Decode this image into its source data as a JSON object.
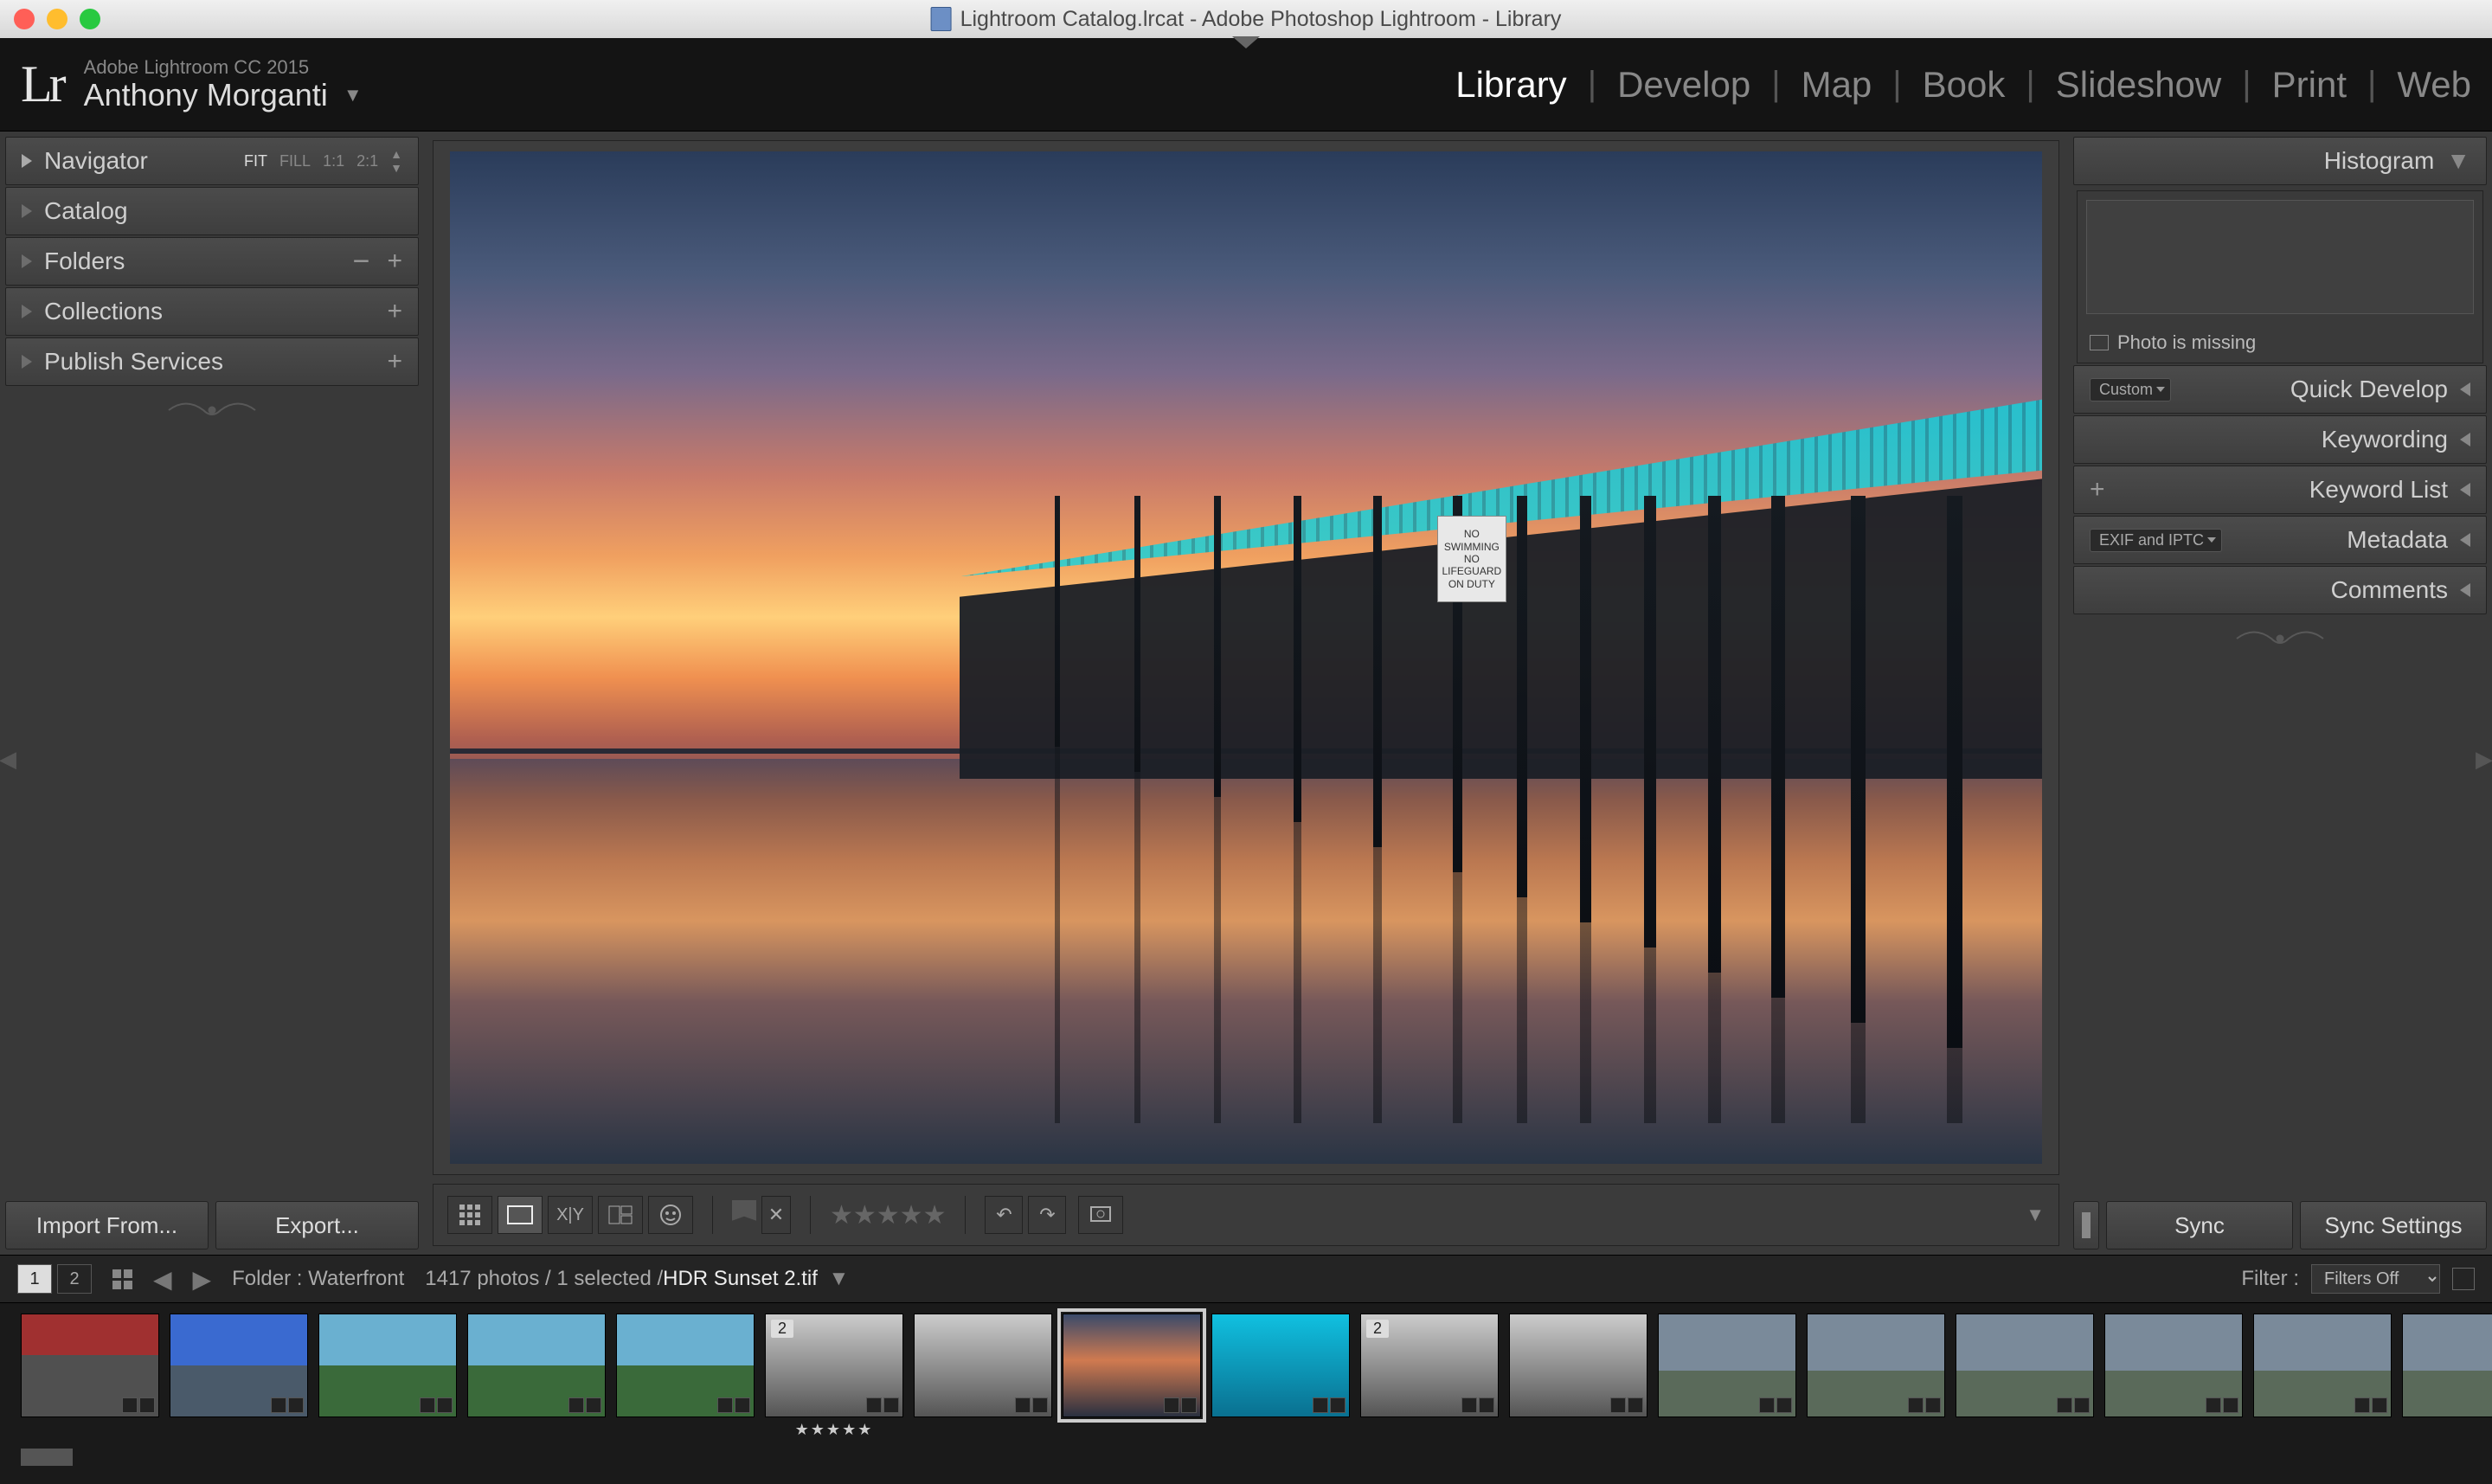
{
  "window": {
    "title": "Lightroom Catalog.lrcat - Adobe Photoshop Lightroom - Library"
  },
  "identity": {
    "product": "Adobe Lightroom CC 2015",
    "user": "Anthony Morganti",
    "logo": "Lr"
  },
  "modules": [
    "Library",
    "Develop",
    "Map",
    "Book",
    "Slideshow",
    "Print",
    "Web"
  ],
  "active_module": "Library",
  "left_panels": {
    "navigator": {
      "label": "Navigator",
      "fit": "FIT",
      "fill": "FILL",
      "one": "1:1",
      "two": "2:1"
    },
    "catalog": "Catalog",
    "folders": "Folders",
    "collections": "Collections",
    "publish": "Publish Services"
  },
  "left_actions": {
    "import": "Import From...",
    "export": "Export..."
  },
  "right_panels": {
    "histogram": "Histogram",
    "histogram_msg": "Photo is missing",
    "quick_develop": {
      "label": "Quick Develop",
      "preset": "Custom"
    },
    "keywording": "Keywording",
    "keyword_list": "Keyword List",
    "metadata": {
      "label": "Metadata",
      "preset": "EXIF and IPTC"
    },
    "comments": "Comments"
  },
  "right_actions": {
    "sync": "Sync",
    "sync_settings": "Sync Settings"
  },
  "sign_lines": [
    "NO SWIMMING",
    "NO LIFEGUARD",
    "ON DUTY"
  ],
  "filmstrip_header": {
    "page_current": "1",
    "page_other": "2",
    "path_label": "Folder : Waterfront",
    "count_text": "1417 photos / 1 selected /",
    "filename": "HDR Sunset 2.tif",
    "filter_label": "Filter :",
    "filter_value": "Filters Off"
  },
  "thumbs": [
    {
      "cls": "t-red"
    },
    {
      "cls": "t-blue"
    },
    {
      "cls": "t-green"
    },
    {
      "cls": "t-green"
    },
    {
      "cls": "t-green"
    },
    {
      "cls": "t-bw",
      "stack": "2",
      "stars": true
    },
    {
      "cls": "t-bw"
    },
    {
      "cls": "t-sunset",
      "sel": true
    },
    {
      "cls": "t-cyan"
    },
    {
      "cls": "t-bw",
      "stack": "2"
    },
    {
      "cls": "t-bw"
    },
    {
      "cls": "t-sky"
    },
    {
      "cls": "t-sky"
    },
    {
      "cls": "t-sky"
    },
    {
      "cls": "t-sky"
    },
    {
      "cls": "t-sky"
    },
    {
      "cls": "t-sky"
    }
  ]
}
